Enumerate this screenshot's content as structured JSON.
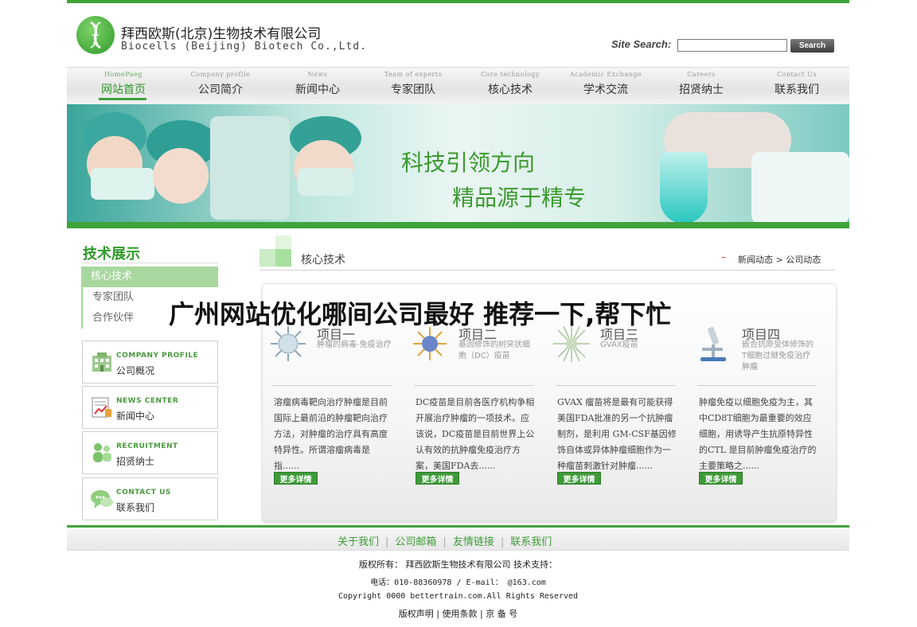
{
  "company": {
    "name_cn": "拜西欧斯(北京)生物技术有限公司",
    "name_en": "Biocells (Beijing) Biotech Co.,Ltd."
  },
  "search": {
    "label": "Site Search:",
    "value": "",
    "button": "Search"
  },
  "nav": [
    {
      "en": "HomePaeg",
      "cn": "网站首页",
      "active": true
    },
    {
      "en": "Company profile",
      "cn": "公司简介"
    },
    {
      "en": "News",
      "cn": "新闻中心"
    },
    {
      "en": "Team of experts",
      "cn": "专家团队"
    },
    {
      "en": "Core technology",
      "cn": "核心技术"
    },
    {
      "en": "Academic Exchange",
      "cn": "学术交流"
    },
    {
      "en": "Careers",
      "cn": "招贤纳士"
    },
    {
      "en": "Contact Us",
      "cn": "联系我们"
    }
  ],
  "banner": {
    "slogan1": "科技引领方向",
    "slogan2": "精品源于精专"
  },
  "sidebar": {
    "title": "技术展示",
    "items": [
      "核心技术",
      "专家团队",
      "合作伙伴"
    ],
    "boxes": [
      {
        "en": "COMPANY PROFILE",
        "cn": "公司概况",
        "icon": "building-icon"
      },
      {
        "en": "NEWS CENTER",
        "cn": "新闻中心",
        "icon": "news-chart-icon"
      },
      {
        "en": "RECRUITMENT",
        "cn": "招贤纳士",
        "icon": "people-icon"
      },
      {
        "en": "CONTACT US",
        "cn": "联系我们",
        "icon": "chat-bubble-icon"
      }
    ]
  },
  "main": {
    "title": "核心技术",
    "breadcrumb": [
      "新闻动态",
      "公司动态"
    ],
    "projects": [
      {
        "name": "项目一",
        "sub": "肿瘤的病毒-免疫治疗",
        "desc": "溶瘤病毒靶向治疗肿瘤是目前国际上最前沿的肿瘤靶向治疗方法，对肿瘤的治疗具有高度特异性。所谓溶瘤病毒是指......",
        "more": "更多详情"
      },
      {
        "name": "项目二",
        "sub": "基因修饰的树突状细胞（DC）疫苗",
        "desc": "DC疫苗是目前各医疗机构争相开展治疗肿瘤的一项技术。应该说，DC疫苗是目前世界上公认有效的抗肿瘤免疫治疗方案，美国FDA去......",
        "more": "更多详情"
      },
      {
        "name": "项目三",
        "sub": "GVAX疫苗",
        "desc": "GVAX 瘤苗将是最有可能获得美国FDA批准的另一个抗肿瘤制剂，是利用 GM-CSF基因修饰自体或异体肿瘤细胞作为一种瘤苗刺激针对肿瘤......",
        "more": "更多详情"
      },
      {
        "name": "项目四",
        "sub": "嵌合抗原受体修饰的T细胞过继免疫治疗肿瘤",
        "desc": "肿瘤免疫以细胞免疫为主，其中CD8T细胞为最重要的效应细胞，用诱导产生抗原特异性的CTL 是目前肿瘤免疫治疗的主要策略之......",
        "more": "更多详情"
      }
    ]
  },
  "headline": "广州网站优化哪间公司最好 推荐一下,帮下忙",
  "footer": {
    "links": [
      "关于我们",
      "公司邮箱",
      "友情链接",
      "联系我们"
    ],
    "line1": "版权所有： 拜西欧斯生物技术有限公司   技术支持：",
    "line2": "电话：010-88360978 / E-mail：      @163.com",
    "line3": "Copyright 0000 bettertrain.com.All Rights Reserved",
    "line4": "版权声明 | 使用条款 |  京    备     号"
  }
}
